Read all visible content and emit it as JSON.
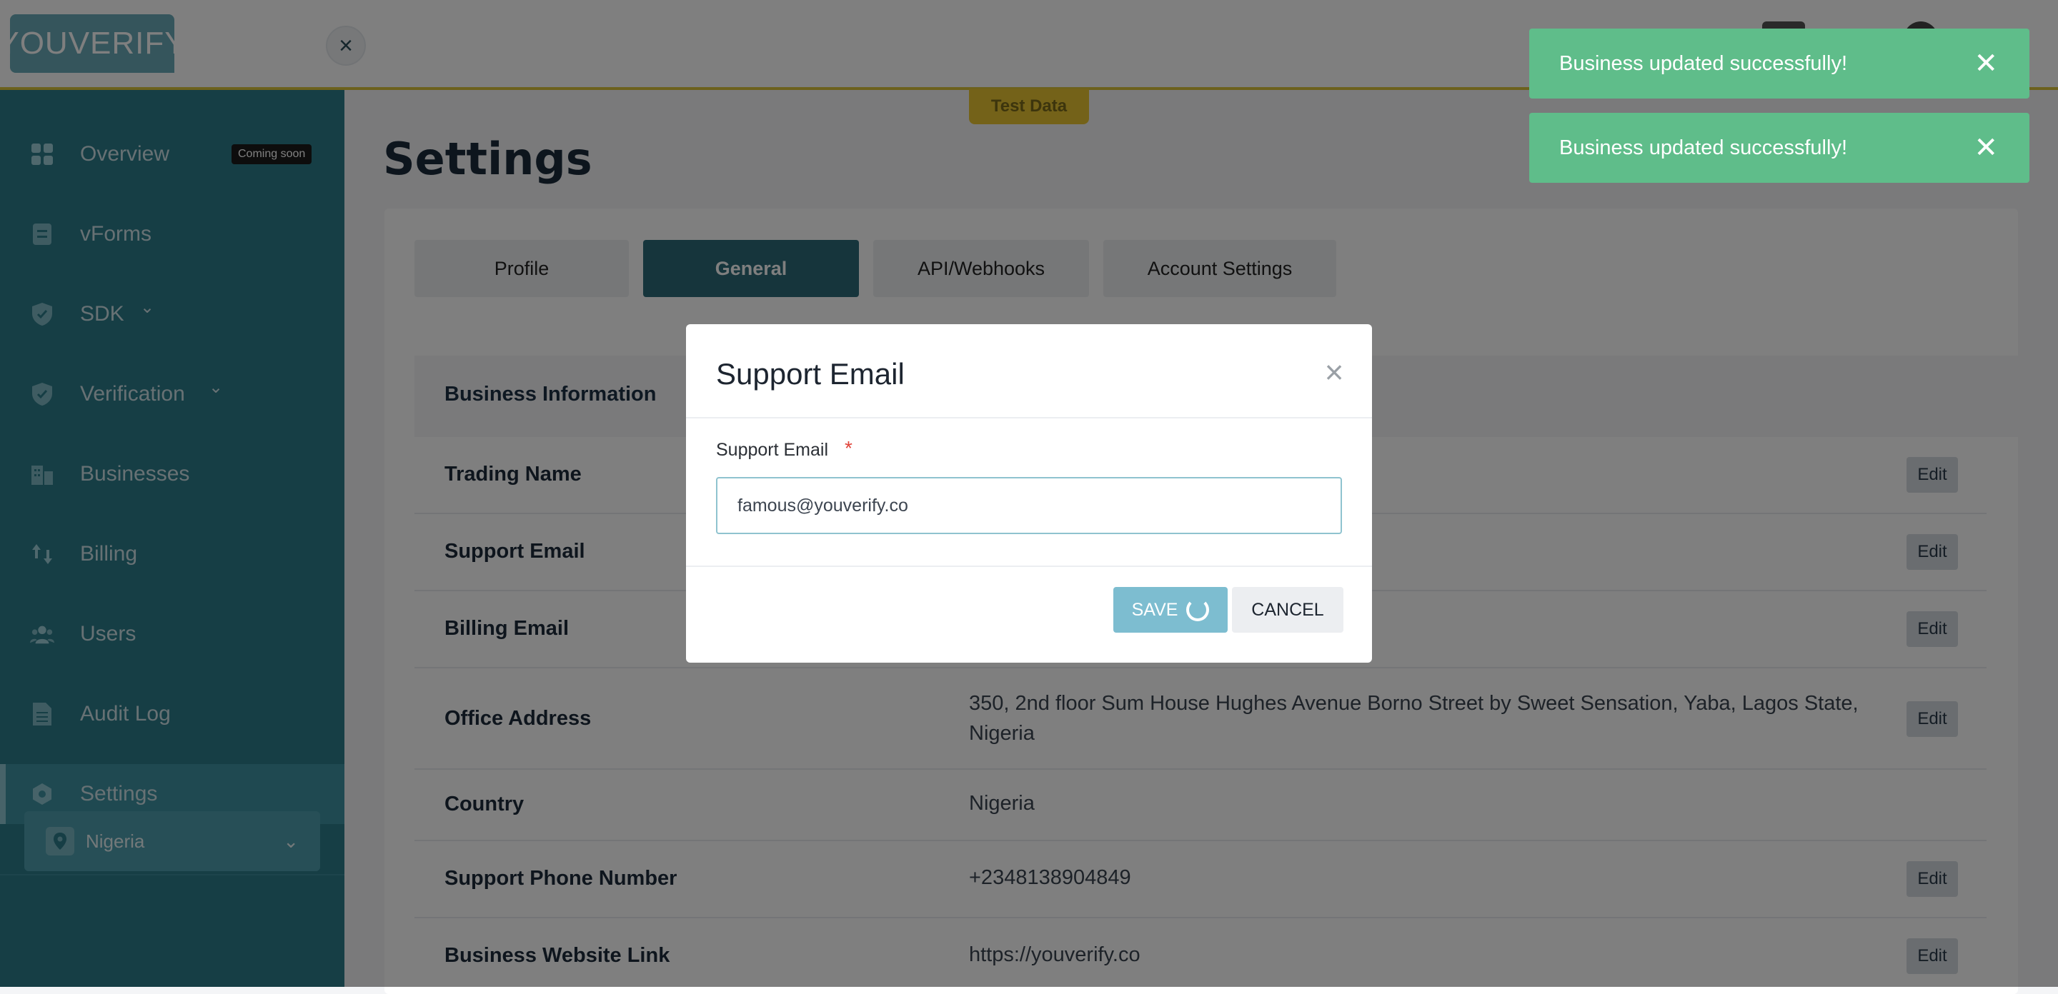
{
  "brand": {
    "logo_text": "YOUVERIFY"
  },
  "header": {
    "close_glyph": "×",
    "test_badge": "Test Data"
  },
  "sidebar": {
    "items": [
      {
        "label": "Overview",
        "icon": "grid-icon",
        "badge": "Coming soon"
      },
      {
        "label": "vForms",
        "icon": "form-icon"
      },
      {
        "label": "SDK",
        "icon": "shield-icon",
        "chevron": "⌄"
      },
      {
        "label": "Verification",
        "icon": "shield-check-icon",
        "chevron": "⌄"
      },
      {
        "label": "Businesses",
        "icon": "building-icon"
      },
      {
        "label": "Billing",
        "icon": "billing-icon"
      },
      {
        "label": "Users",
        "icon": "users-icon"
      },
      {
        "label": "Audit Log",
        "icon": "document-icon"
      },
      {
        "label": "Settings",
        "icon": "settings-icon",
        "active": true
      }
    ],
    "country": {
      "label": "Nigeria",
      "icon": "location-pin-icon"
    }
  },
  "page": {
    "title": "Settings",
    "tabs": [
      {
        "label": "Profile"
      },
      {
        "label": "General",
        "active": true
      },
      {
        "label": "API/Webhooks"
      },
      {
        "label": "Account Settings"
      }
    ],
    "section_title": "Business Information",
    "edit_label": "Edit",
    "rows": [
      {
        "label": "Trading Name",
        "value": "",
        "editable": true
      },
      {
        "label": "Support Email",
        "value": "",
        "editable": true
      },
      {
        "label": "Billing Email",
        "value": "",
        "editable": true
      },
      {
        "label": "Office Address",
        "value": "350, 2nd floor Sum House Hughes Avenue Borno Street by Sweet Sensation, Yaba, Lagos State, Nigeria",
        "editable": true
      },
      {
        "label": "Country",
        "value": "Nigeria",
        "editable": false
      },
      {
        "label": "Support Phone Number",
        "value": "+2348138904849",
        "editable": true
      },
      {
        "label": "Business Website Link",
        "value": "https://youverify.co",
        "editable": true
      }
    ]
  },
  "modal": {
    "title": "Support Email",
    "close_glyph": "×",
    "field_label": "Support Email",
    "required_mark": "*",
    "input_value": "famous@youverify.co",
    "save_label": "SAVE",
    "cancel_label": "CANCEL"
  },
  "toasts": [
    {
      "message": "Business updated successfully!",
      "close_glyph": "✕"
    },
    {
      "message": "Business updated successfully!",
      "close_glyph": "✕"
    }
  ],
  "colors": {
    "sidebar": "#2d7c8a",
    "active_tab": "#2d6a78",
    "toast": "#5fbd8a",
    "save_button": "#7dbdd0",
    "test_badge": "#e8c533"
  }
}
